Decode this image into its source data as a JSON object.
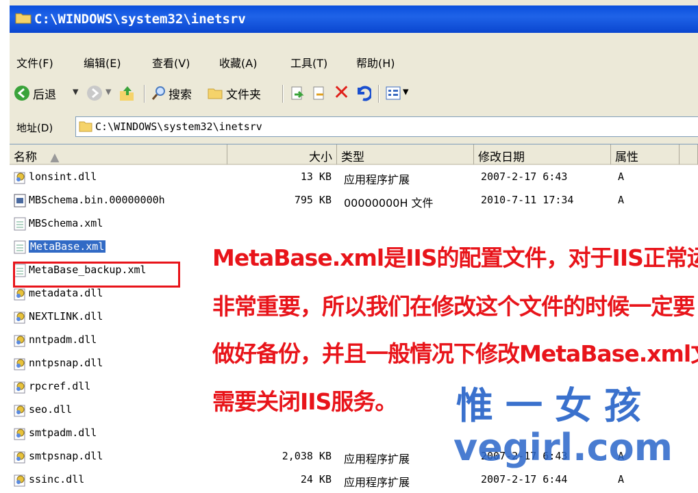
{
  "window": {
    "title": "C:\\WINDOWS\\system32\\inetsrv"
  },
  "menu": [
    "文件(F)",
    "编辑(E)",
    "查看(V)",
    "收藏(A)",
    "工具(T)",
    "帮助(H)"
  ],
  "toolbar": {
    "back": "后退",
    "search": "搜索",
    "folders": "文件夹"
  },
  "address": {
    "label": "地址(D)",
    "path": "C:\\WINDOWS\\system32\\inetsrv"
  },
  "columns": {
    "name": "名称",
    "size": "大小",
    "type": "类型",
    "date": "修改日期",
    "attr": "属性"
  },
  "files": [
    {
      "name": "lonsint.dll",
      "size": "13 KB",
      "type": "应用程序扩展",
      "date": "2007-2-17 6:43",
      "attr": "A"
    },
    {
      "name": "MBSchema.bin.00000000h",
      "size": "795 KB",
      "type": "00000000H 文件",
      "date": "2010-7-11 17:34",
      "attr": "A"
    },
    {
      "name": "MBSchema.xml",
      "size": "",
      "type": "",
      "date": "",
      "attr": ""
    },
    {
      "name": "MetaBase.xml",
      "size": "",
      "type": "",
      "date": "",
      "attr": ""
    },
    {
      "name": "MetaBase_backup.xml",
      "size": "",
      "type": "",
      "date": "",
      "attr": ""
    },
    {
      "name": "metadata.dll",
      "size": "",
      "type": "",
      "date": "",
      "attr": ""
    },
    {
      "name": "NEXTLINK.dll",
      "size": "",
      "type": "",
      "date": "",
      "attr": ""
    },
    {
      "name": "nntpadm.dll",
      "size": "",
      "type": "",
      "date": "",
      "attr": ""
    },
    {
      "name": "nntpsnap.dll",
      "size": "",
      "type": "",
      "date": "",
      "attr": ""
    },
    {
      "name": "rpcref.dll",
      "size": "",
      "type": "",
      "date": "",
      "attr": ""
    },
    {
      "name": "seo.dll",
      "size": "",
      "type": "",
      "date": "",
      "attr": ""
    },
    {
      "name": "smtpadm.dll",
      "size": "",
      "type": "",
      "date": "",
      "attr": ""
    },
    {
      "name": "smtpsnap.dll",
      "size": "2,038 KB",
      "type": "应用程序扩展",
      "date": "2007-2-17 6:43",
      "attr": "A"
    },
    {
      "name": "ssinc.dll",
      "size": "24 KB",
      "type": "应用程序扩展",
      "date": "2007-2-17 6:44",
      "attr": "A"
    }
  ],
  "annotation": [
    "MetaBase.xml是IIS的配置文件，对于IIS正常运行",
    "非常重要，所以我们在修改这个文件的时候一定要",
    "做好备份，并且一般情况下修改MetaBase.xml文件",
    "需要关闭IIS服务。"
  ],
  "watermark": {
    "line1": "惟一女孩",
    "line2": "vegirl.com"
  },
  "colors": {
    "title_bar": "#0a4fdc",
    "selection": "#316ac5",
    "annotation": "#e8141a",
    "watermark": "#2a66c9"
  }
}
